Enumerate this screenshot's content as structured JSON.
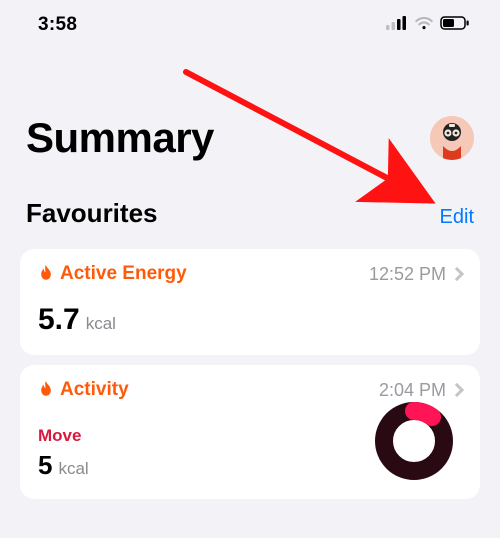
{
  "status": {
    "time": "3:58"
  },
  "header": {
    "title": "Summary"
  },
  "favourites": {
    "title": "Favourites",
    "edit_label": "Edit"
  },
  "cards": {
    "active_energy": {
      "title": "Active Energy",
      "time": "12:52 PM",
      "value": "5.7",
      "unit": "kcal"
    },
    "activity": {
      "title": "Activity",
      "time": "2:04 PM",
      "move_label": "Move",
      "value": "5",
      "unit": "kcal"
    }
  }
}
